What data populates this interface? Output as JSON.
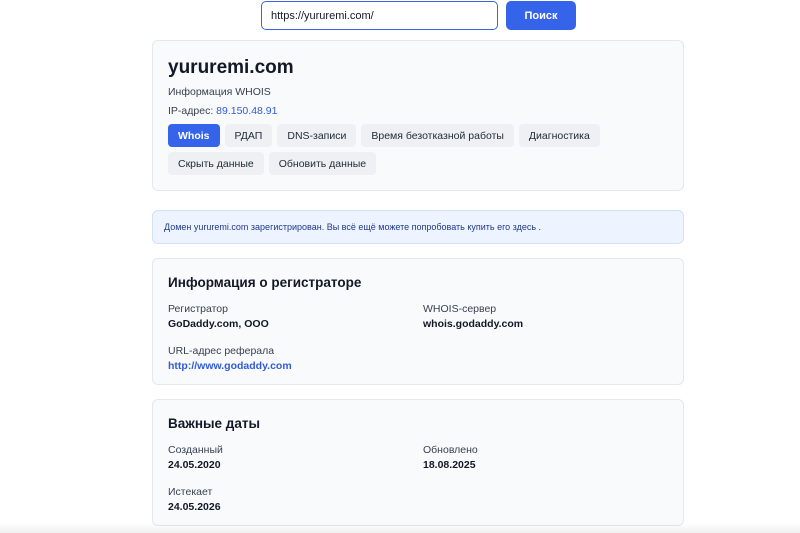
{
  "search": {
    "value": "https://yururemi.com/",
    "button_label": "Поиск"
  },
  "domain_card": {
    "title": "yururemi.com",
    "subtitle": "Информация WHOIS",
    "ip_label": "IP-адрес:",
    "ip_value": "89.150.48.91",
    "tabs": [
      {
        "label": "Whois",
        "active": true
      },
      {
        "label": "РДАП"
      },
      {
        "label": "DNS-записи"
      },
      {
        "label": "Время безотказной работы"
      },
      {
        "label": "Диагностика"
      },
      {
        "label": "Скрыть данные"
      },
      {
        "label": "Обновить данные"
      }
    ]
  },
  "notice": {
    "prefix": "Домен",
    "domain": "yururemi.com",
    "text": "зарегистрирован. Вы всё ещё можете попробовать купить его здесь ."
  },
  "registrar": {
    "title": "Информация о регистраторе",
    "registrar_label": "Регистратор",
    "registrar_value": "GoDaddy.com, ООО",
    "whois_label": "WHOIS-сервер",
    "whois_value": "whois.godaddy.com",
    "url_label": "URL-адрес реферала",
    "url_value": "http://www.godaddy.com"
  },
  "dates": {
    "title": "Важные даты",
    "created_label": "Созданный",
    "created_value": "24.05.2020",
    "updated_label": "Обновлено",
    "updated_value": "18.08.2025",
    "expires_label": "Истекает",
    "expires_value": "24.05.2026"
  },
  "colors": {
    "accent": "#3563e9",
    "link": "#2f5bd8",
    "card_bg": "#f9fafb",
    "notice_bg": "#eef4ff"
  }
}
